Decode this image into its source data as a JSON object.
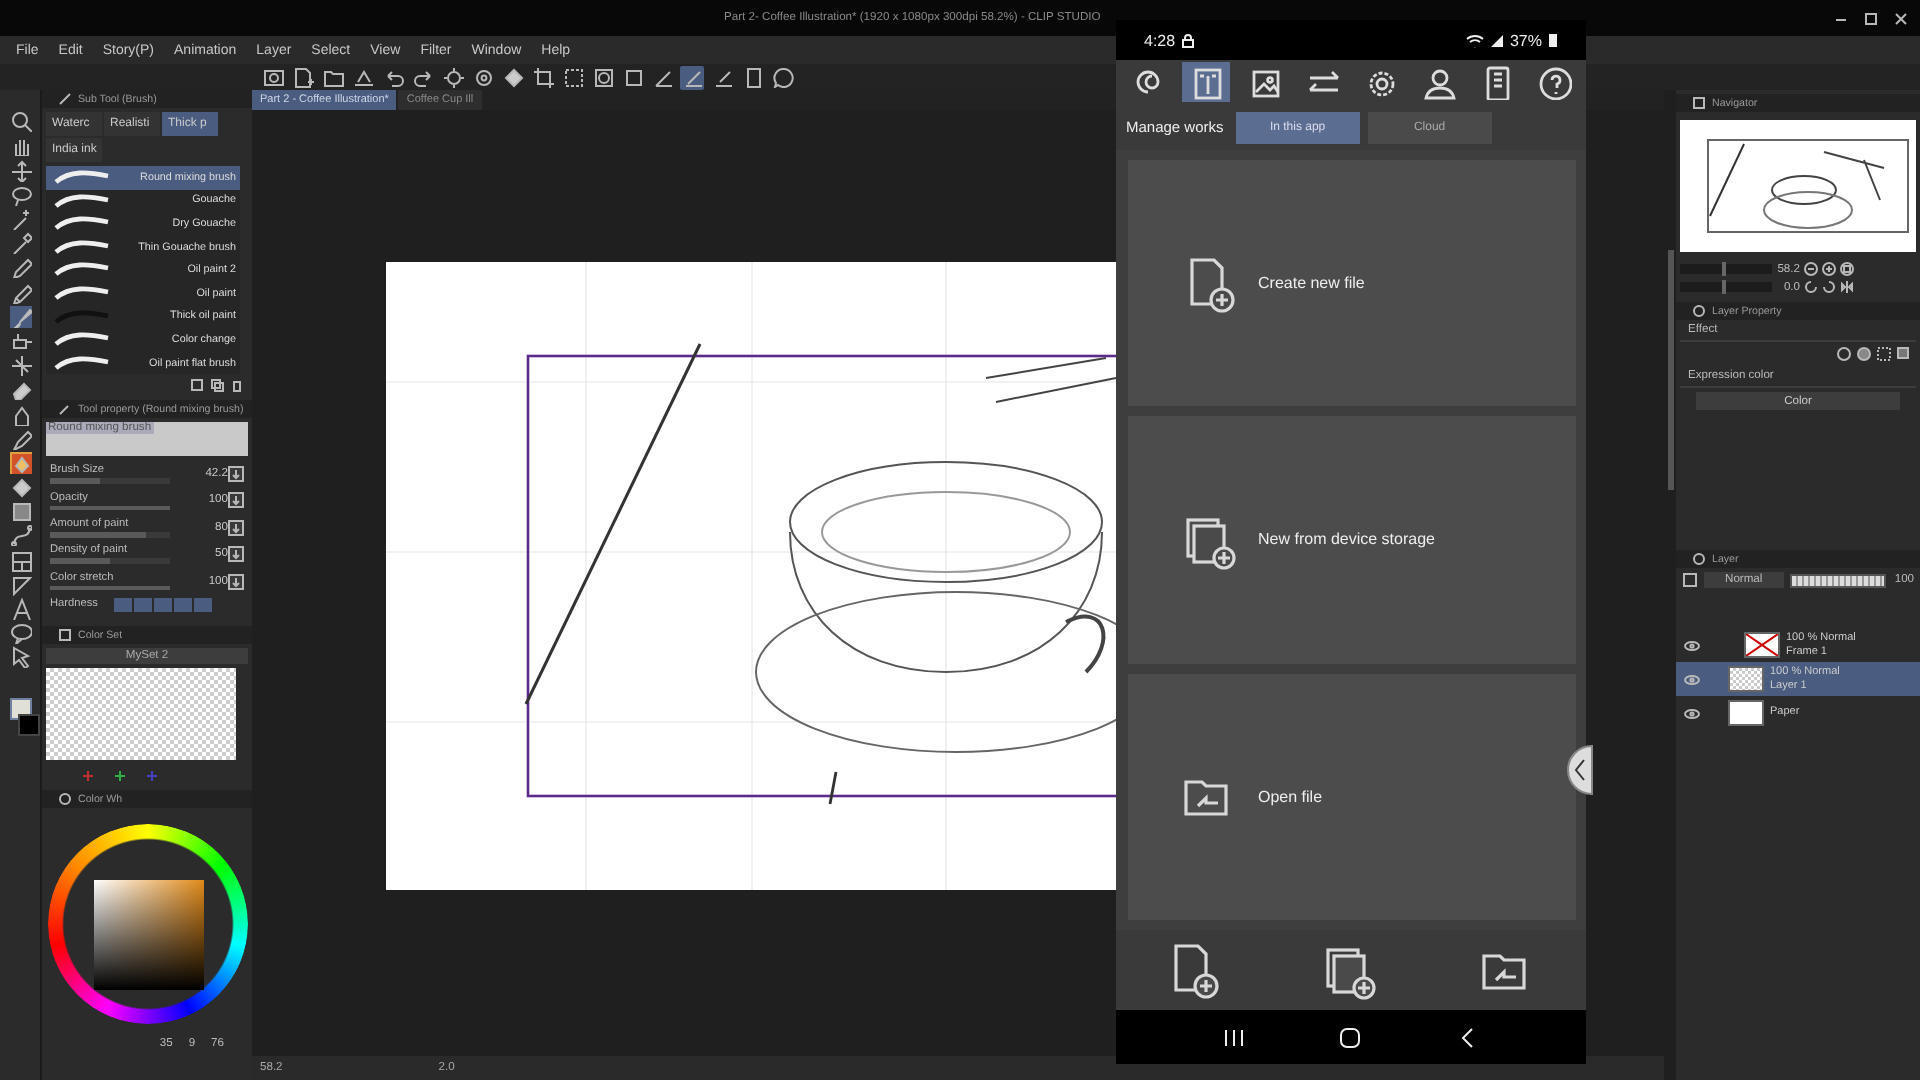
{
  "window": {
    "title": "Part 2- Coffee Illustration* (1920 x 1080px 300dpi 58.2%) - CLIP STUDIO"
  },
  "menu": [
    "File",
    "Edit",
    "Story(P)",
    "Animation",
    "Layer",
    "Select",
    "View",
    "Filter",
    "Window",
    "Help"
  ],
  "document_tabs": [
    {
      "label": "Part 2 - Coffee Illustration*",
      "selected": true
    },
    {
      "label": "Coffee Cup Ill",
      "selected": false
    }
  ],
  "sub_tool": {
    "title": "Sub Tool (Brush)",
    "groups": [
      {
        "label": "Waterc",
        "selected": false
      },
      {
        "label": "Realisti",
        "selected": false
      },
      {
        "label": "Thick p",
        "selected": true
      },
      {
        "label": "India ink",
        "selected": false
      }
    ],
    "brushes": [
      {
        "name": "Round mixing brush",
        "selected": true
      },
      {
        "name": "Gouache",
        "selected": false
      },
      {
        "name": "Dry Gouache",
        "selected": false
      },
      {
        "name": "Thin Gouache brush",
        "selected": false
      },
      {
        "name": "Oil paint 2",
        "selected": false
      },
      {
        "name": "Oil paint",
        "selected": false
      },
      {
        "name": "Thick oil paint",
        "selected": false
      },
      {
        "name": "Color change",
        "selected": false
      },
      {
        "name": "Oil paint flat brush",
        "selected": false
      }
    ]
  },
  "tool_property": {
    "title": "Tool property (Round mixing brush)",
    "preview_label": "Round mixing brush",
    "properties": [
      {
        "label": "Brush Size",
        "value": "42.2",
        "level": 0.42
      },
      {
        "label": "Opacity",
        "value": "100",
        "level": 1
      },
      {
        "label": "Amount of paint",
        "value": "80",
        "level": 0.8
      },
      {
        "label": "Density of paint",
        "value": "50",
        "level": 0.5
      },
      {
        "label": "Color stretch",
        "value": "100",
        "level": 1
      }
    ],
    "hardness_label": "Hardness"
  },
  "color_set": {
    "title": "Color Set",
    "set_name": "MySet 2"
  },
  "color_wheel": {
    "title": "Color Wh",
    "readouts": [
      "35",
      "9",
      "76"
    ]
  },
  "canvas_status": {
    "zoom": "58.2",
    "angle": "2.0"
  },
  "phone": {
    "time": "4:28",
    "battery": "37%",
    "nav_items": [
      {
        "selected": false
      },
      {
        "selected": true
      },
      {
        "selected": false
      },
      {
        "selected": false
      },
      {
        "selected": false
      },
      {
        "selected": false
      },
      {
        "selected": false
      },
      {
        "selected": false
      }
    ],
    "section_label": "Manage works",
    "tabs": [
      {
        "label": "In this app",
        "selected": true
      },
      {
        "label": "Cloud",
        "selected": false
      }
    ],
    "cards": [
      {
        "label": "Create new file",
        "kind": "new"
      },
      {
        "label": "New from device storage",
        "kind": "device"
      },
      {
        "label": "Open file",
        "kind": "open"
      }
    ]
  },
  "navigator": {
    "title": "Navigator",
    "zoom": {
      "value": "58.2",
      "level": 0.45
    },
    "rotation": {
      "value": "0.0",
      "level": 0.45
    }
  },
  "layer_property": {
    "title": "Layer Property",
    "effect_label": "Effect",
    "expression_label": "Expression color",
    "expression_value": "Color"
  },
  "layer_panel": {
    "title": "Layer",
    "blend_mode": "Normal",
    "opacity": {
      "value": "100",
      "level": 1
    },
    "layers": [
      {
        "mode": "100 % Normal",
        "name": "Frame 1",
        "kind": "frame",
        "selected": false
      },
      {
        "mode": "100 % Normal",
        "name": "Layer 1",
        "kind": "raster",
        "selected": true
      },
      {
        "name": "Paper",
        "kind": "paper",
        "selected": false
      }
    ]
  }
}
